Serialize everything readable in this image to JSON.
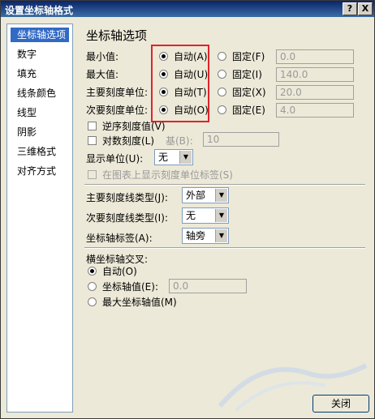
{
  "window": {
    "title": "设置坐标轴格式",
    "help_label": "?",
    "close_label": "X"
  },
  "nav": {
    "items": [
      "坐标轴选项",
      "数字",
      "填充",
      "线条颜色",
      "线型",
      "阴影",
      "三维格式",
      "对齐方式"
    ],
    "selected": 0
  },
  "panel": {
    "heading": "坐标轴选项",
    "rows": [
      {
        "label": "最小值:",
        "auto": "自动(A)",
        "fixed": "固定(F)",
        "value": "0.0"
      },
      {
        "label": "最大值:",
        "auto": "自动(U)",
        "fixed": "固定(I)",
        "value": "140.0"
      },
      {
        "label": "主要刻度单位:",
        "auto": "自动(T)",
        "fixed": "固定(X)",
        "value": "20.0"
      },
      {
        "label": "次要刻度单位:",
        "auto": "自动(O)",
        "fixed": "固定(E)",
        "value": "4.0"
      }
    ],
    "reverse_label": "逆序刻度值(V)",
    "log_label": "对数刻度(L)",
    "log_base_label": "基(B):",
    "log_base_value": "10",
    "display_units_label": "显示单位(U):",
    "display_units_value": "无",
    "show_units_label": "在图表上显示刻度单位标签(S)",
    "major_tick_label": "主要刻度线类型(J):",
    "major_tick_value": "外部",
    "minor_tick_label": "次要刻度线类型(I):",
    "minor_tick_value": "无",
    "axis_labels_label": "坐标轴标签(A):",
    "axis_labels_value": "轴旁",
    "cross_title": "横坐标轴交叉:",
    "cross_auto": "自动(O)",
    "cross_value_label": "坐标轴值(E):",
    "cross_value": "0.0",
    "cross_max": "最大坐标轴值(M)"
  },
  "footer": {
    "close_label": "关闭"
  },
  "colors": {
    "highlight": "#e0232b",
    "nav_selected": "#316ac5"
  }
}
